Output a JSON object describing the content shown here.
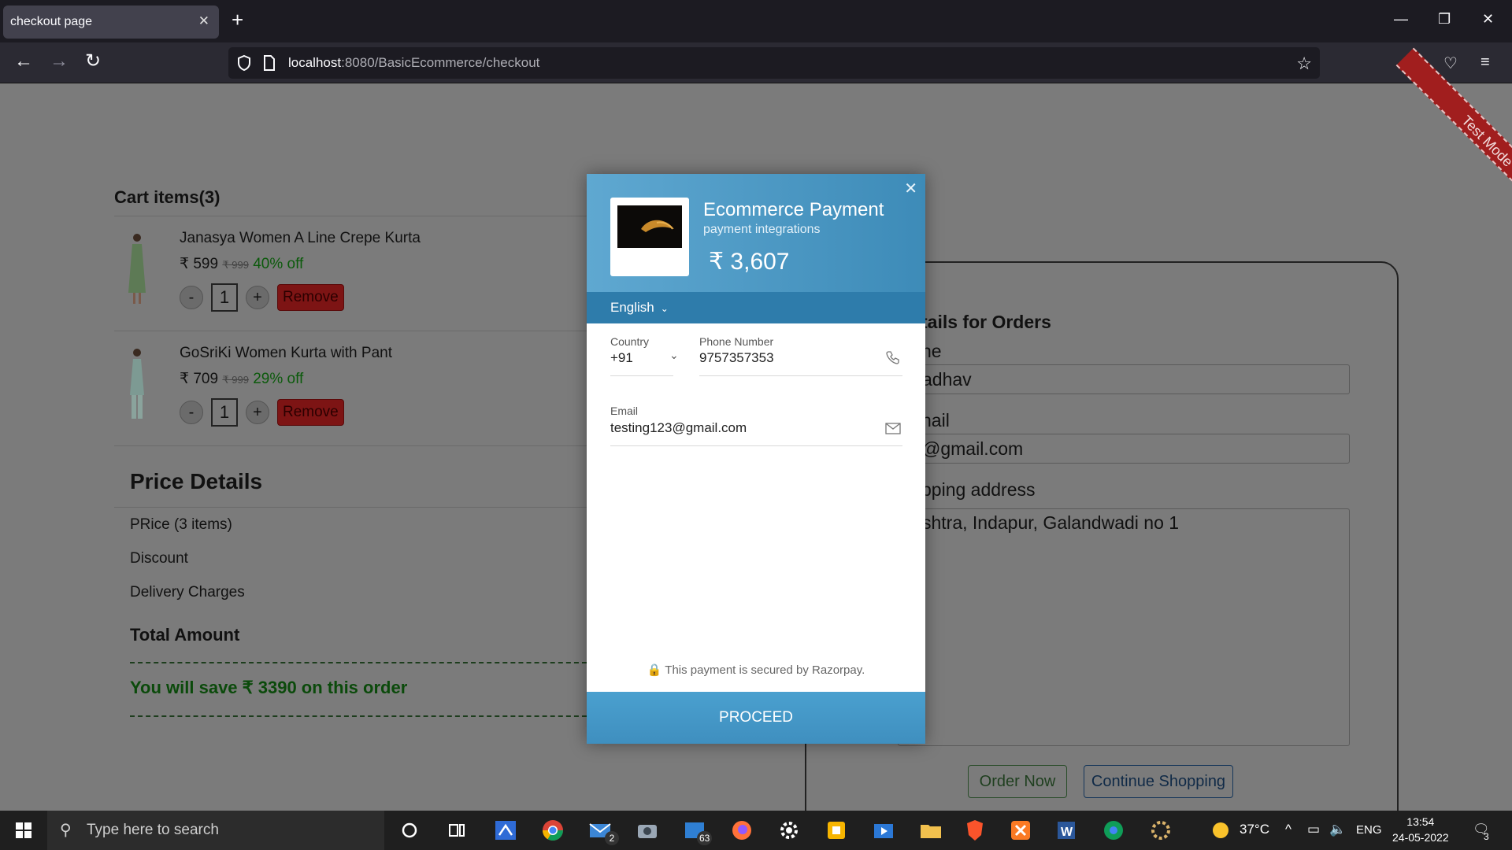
{
  "browser": {
    "tab_title": "checkout page",
    "url_host": "localhost",
    "url_path": ":8080/BasicEcommerce/checkout"
  },
  "cart": {
    "title": "Cart items(3)",
    "items": [
      {
        "name": "Janasya Women A Line Crepe Kurta",
        "price": "₹ 599",
        "mrp": "₹ 999",
        "discount": "40% off",
        "qty": "1",
        "remove": "Remove"
      },
      {
        "name": "GoSriKi Women Kurta with Pant",
        "price": "₹ 709",
        "mrp": "₹ 999",
        "discount": "29% off",
        "qty": "1",
        "remove": "Remove"
      }
    ],
    "minus": "-",
    "plus": "+"
  },
  "price_details": {
    "title": "Price Details",
    "price_label": "PRice (3 items)",
    "discount_label": "Discount",
    "delivery_label": "Delivery Charges",
    "total_label": "Total Amount",
    "savings": "You will save ₹ 3390 on this order"
  },
  "order_form": {
    "title": "tails for Orders",
    "name_label": "ne",
    "name_value": "adhav",
    "email_label": "nail",
    "email_value": "@gmail.com",
    "address_label": "pping address",
    "address_value": "shtra, Indapur, Galandwadi no 1",
    "order_button": "Order Now",
    "continue_button": "Continue Shopping"
  },
  "test_mode_label": "Test Mode",
  "payment_modal": {
    "merchant": "Ecommerce Payment",
    "subtitle": "payment integrations",
    "amount": "₹ 3,607",
    "language": "English",
    "country_label": "Country",
    "country_code": "+91",
    "phone_label": "Phone Number",
    "phone_value": "9757357353",
    "email_label": "Email",
    "email_value": "testing123@gmail.com",
    "secure_text": "This payment is secured by Razorpay.",
    "proceed": "PROCEED"
  },
  "taskbar": {
    "search_placeholder": "Type here to search",
    "mail_badge": "2",
    "store_badge": "63",
    "temperature": "37°C",
    "language": "ENG",
    "time": "13:54",
    "date": "24-05-2022",
    "notifications": "3"
  }
}
